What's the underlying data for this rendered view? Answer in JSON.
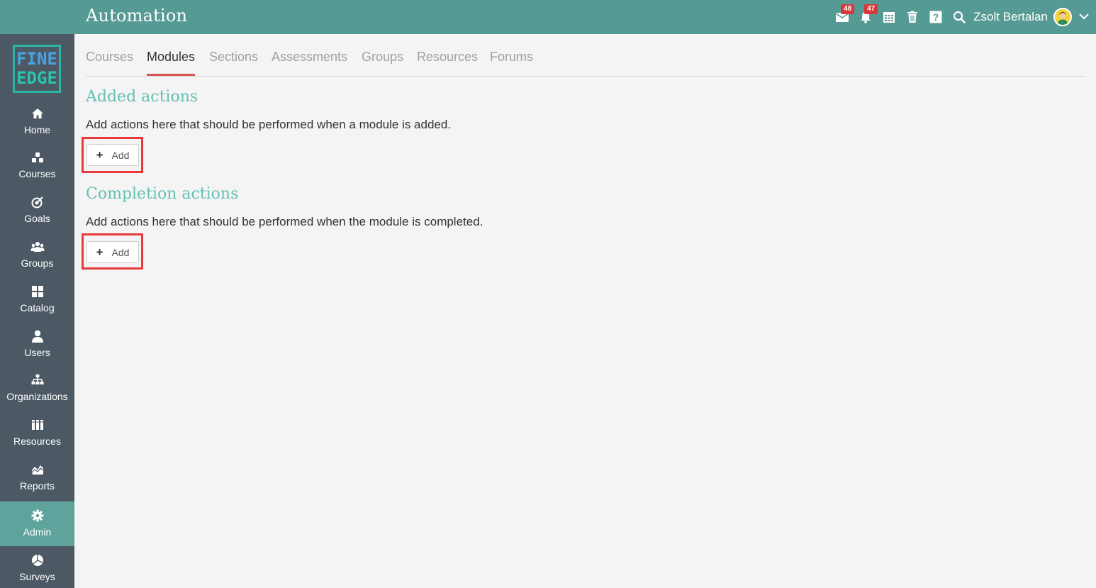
{
  "header": {
    "title": "Automation",
    "messages_badge": "48",
    "notifications_badge": "47",
    "user_name": "Zsolt Bertalan"
  },
  "logo": {
    "line1": "FINE",
    "line2": "EDGE"
  },
  "sidebar": {
    "items": [
      {
        "label": "Home",
        "icon": "home-icon"
      },
      {
        "label": "Courses",
        "icon": "courses-icon"
      },
      {
        "label": "Goals",
        "icon": "target-icon"
      },
      {
        "label": "Groups",
        "icon": "groups-icon"
      },
      {
        "label": "Catalog",
        "icon": "grid-icon"
      },
      {
        "label": "Users",
        "icon": "user-icon"
      },
      {
        "label": "Organizations",
        "icon": "org-chart-icon"
      },
      {
        "label": "Resources",
        "icon": "books-icon"
      },
      {
        "label": "Reports",
        "icon": "chart-icon"
      },
      {
        "label": "Admin",
        "icon": "gear-icon"
      },
      {
        "label": "Surveys",
        "icon": "pie-icon"
      }
    ],
    "active": "Admin"
  },
  "tabs": [
    {
      "label": "Courses"
    },
    {
      "label": "Modules"
    },
    {
      "label": "Sections"
    },
    {
      "label": "Assessments"
    },
    {
      "label": "Groups"
    },
    {
      "label": "Resources"
    },
    {
      "label": "Forums"
    }
  ],
  "active_tab": "Modules",
  "added": {
    "title": "Added actions",
    "description": "Add actions here that should be performed when a module is added.",
    "button_label": "Add"
  },
  "completion": {
    "title": "Completion actions",
    "description": "Add actions here that should be performed when the module is completed.",
    "button_label": "Add"
  },
  "colors": {
    "topbar": "#559a94",
    "sidebar": "#4c5965",
    "accent_title": "#64c0b4",
    "active_tab_underline": "#d9534f",
    "highlight": "#e8393d",
    "badge": "#d9383a"
  }
}
